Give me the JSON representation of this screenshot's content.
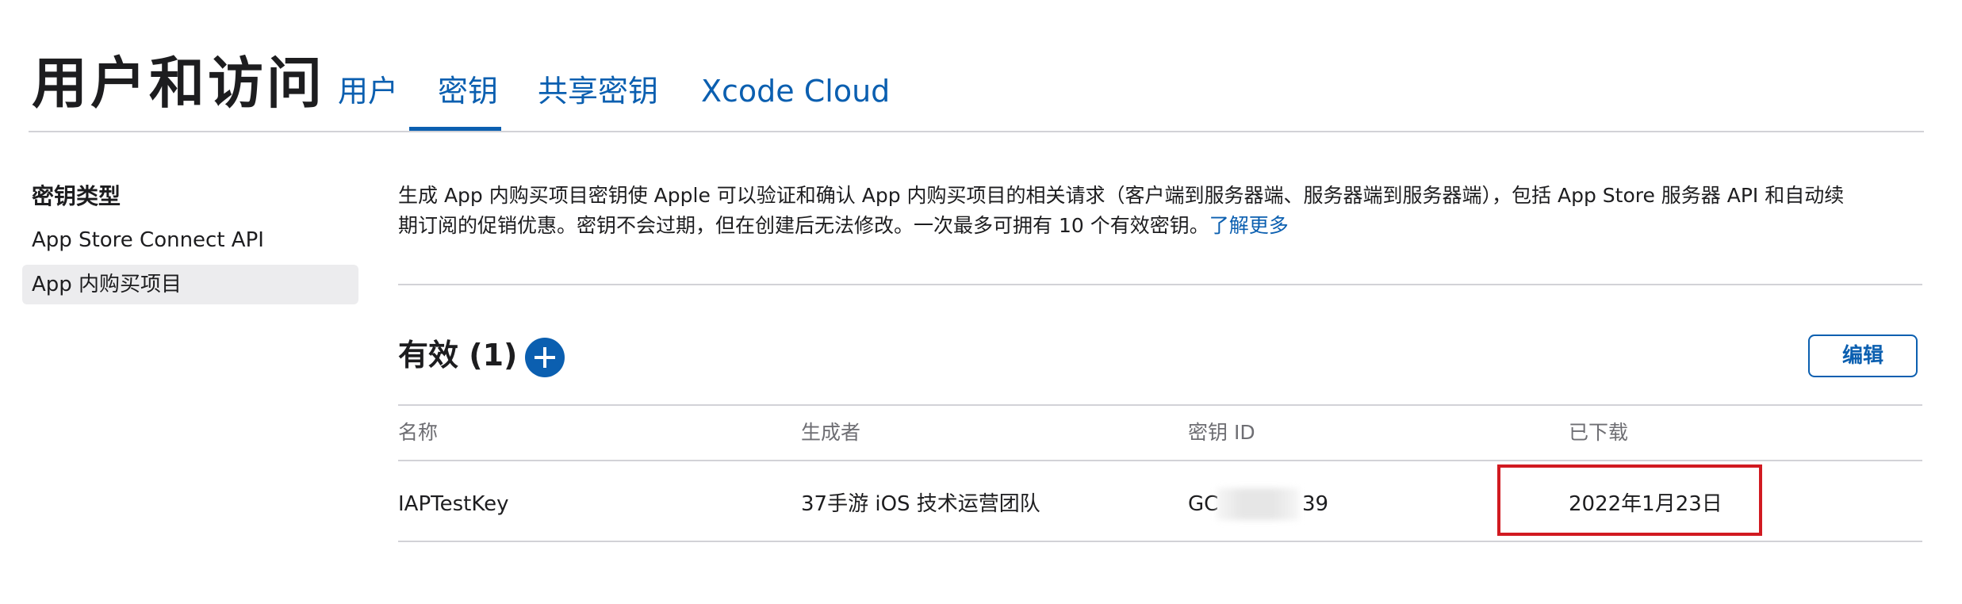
{
  "header": {
    "title": "用户和访问",
    "tabs": [
      {
        "label": "用户",
        "active": false
      },
      {
        "label": "密钥",
        "active": true
      },
      {
        "label": "共享密钥",
        "active": false
      },
      {
        "label": "Xcode Cloud",
        "active": false
      }
    ]
  },
  "sidebar": {
    "heading": "密钥类型",
    "items": [
      {
        "label": "App Store Connect API",
        "selected": false
      },
      {
        "label": "App 内购买项目",
        "selected": true
      }
    ]
  },
  "main": {
    "description_line1": "生成 App 内购买项目密钥使 Apple 可以验证和确认 App 内购买项目的相关请求（客户端到服务器端、服务器端到服务器端），包括 App Store 服务器 API 和自动续",
    "description_line2": "期订阅的促销优惠。密钥不会过期，但在创建后无法修改。一次最多可拥有 10 个有效密钥。",
    "learn_more": "了解更多",
    "section_title": "有效 (1)",
    "edit_label": "编辑",
    "table": {
      "columns": [
        "名称",
        "生成者",
        "密钥 ID",
        "已下载"
      ],
      "rows": [
        {
          "name": "IAPTestKey",
          "creator": "37手游 iOS 技术运营团队",
          "key_id_prefix": "GC",
          "key_id_suffix": "39",
          "downloaded": "2022年1月23日"
        }
      ]
    }
  },
  "colors": {
    "accent": "#0b5fb0",
    "highlight": "#d11a21",
    "divider": "#d2d2d7",
    "muted_text": "#6e6e73"
  },
  "icons": {
    "add": "plus-circle-icon"
  }
}
